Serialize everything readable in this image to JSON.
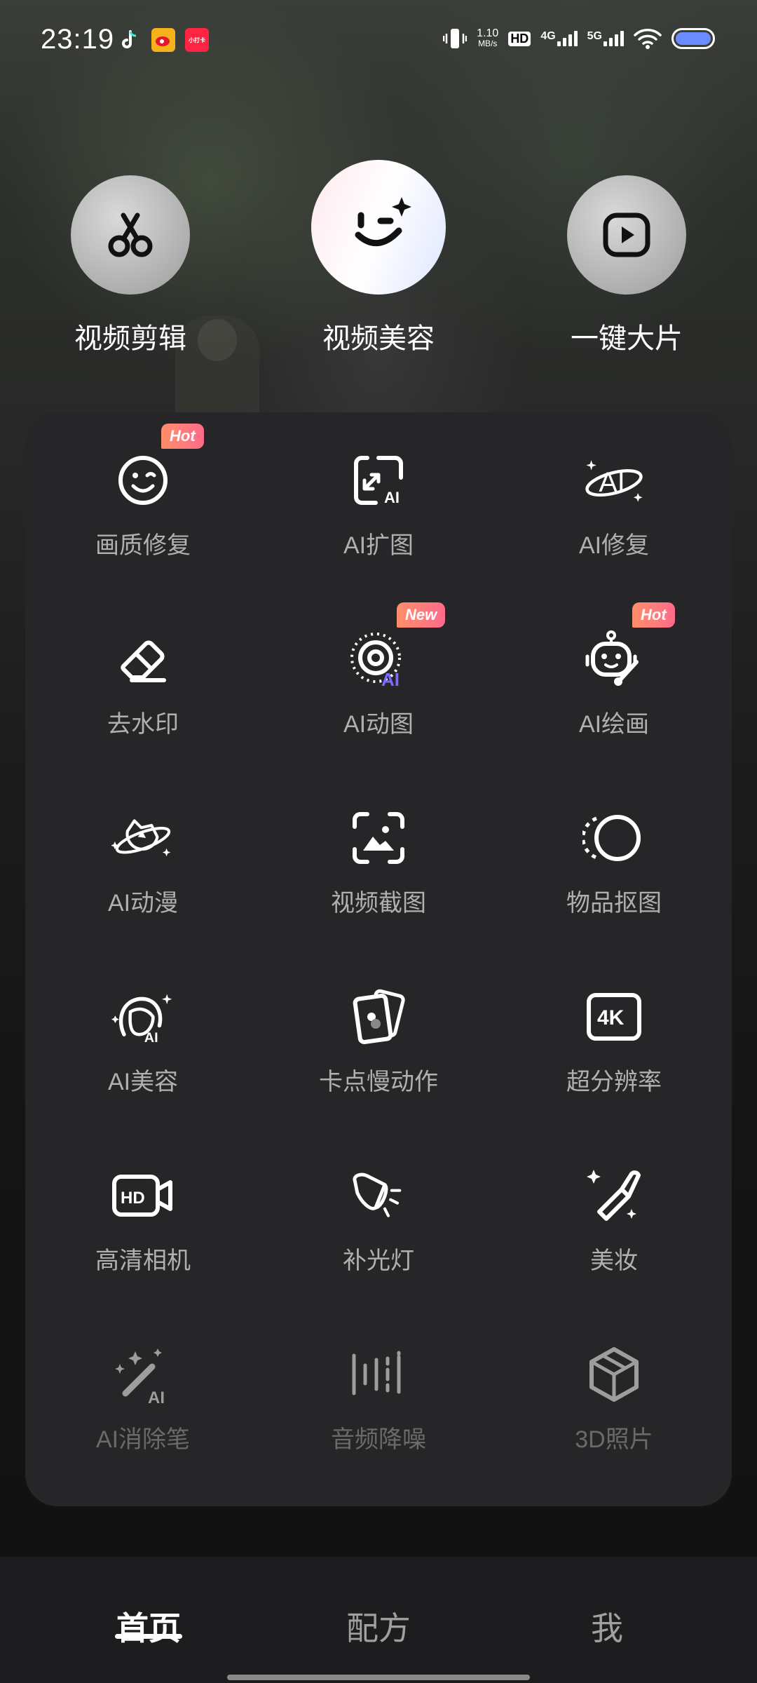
{
  "status": {
    "time": "23:19",
    "speed_value": "1.10",
    "speed_unit": "MB/s",
    "hd_label": "HD",
    "net1": "4G",
    "net2": "5G",
    "mini_app": "小打卡"
  },
  "top_actions": [
    {
      "label": "视频剪辑",
      "icon": "scissors-icon"
    },
    {
      "label": "视频美容",
      "icon": "wink-face-icon"
    },
    {
      "label": "一键大片",
      "icon": "play-icon"
    }
  ],
  "tools": [
    {
      "label": "画质修复",
      "icon": "smile-face-icon",
      "badge": "Hot"
    },
    {
      "label": "AI扩图",
      "icon": "ai-expand-icon"
    },
    {
      "label": "AI修复",
      "icon": "ai-orbit-icon"
    },
    {
      "label": "去水印",
      "icon": "eraser-icon"
    },
    {
      "label": "AI动图",
      "icon": "ai-motion-icon",
      "badge": "New"
    },
    {
      "label": "AI绘画",
      "icon": "robot-brush-icon",
      "badge": "Hot"
    },
    {
      "label": "AI动漫",
      "icon": "planet-icon"
    },
    {
      "label": "视频截图",
      "icon": "screenshot-frame-icon"
    },
    {
      "label": "物品抠图",
      "icon": "cutout-circle-icon"
    },
    {
      "label": "AI美容",
      "icon": "ai-face-icon"
    },
    {
      "label": "卡点慢动作",
      "icon": "cards-icon"
    },
    {
      "label": "超分辨率",
      "icon": "4k-icon",
      "icon_text": "4K"
    },
    {
      "label": "高清相机",
      "icon": "hd-camera-icon",
      "icon_text": "HD"
    },
    {
      "label": "补光灯",
      "icon": "spotlight-icon"
    },
    {
      "label": "美妆",
      "icon": "lipstick-icon"
    },
    {
      "label": "AI消除笔",
      "icon": "magic-wand-icon"
    },
    {
      "label": "音频降噪",
      "icon": "audio-wave-icon"
    },
    {
      "label": "3D照片",
      "icon": "cube-icon"
    }
  ],
  "ai_text": "AI",
  "bottom_nav": [
    {
      "label": "首页",
      "active": true
    },
    {
      "label": "配方",
      "active": false
    },
    {
      "label": "我",
      "active": false
    }
  ],
  "colors": {
    "panel": "#262628",
    "badge_start": "#ff8e6a",
    "badge_end": "#ff6b8b",
    "ai_purple": "#7b6bff",
    "battery": "#6a8cff"
  }
}
